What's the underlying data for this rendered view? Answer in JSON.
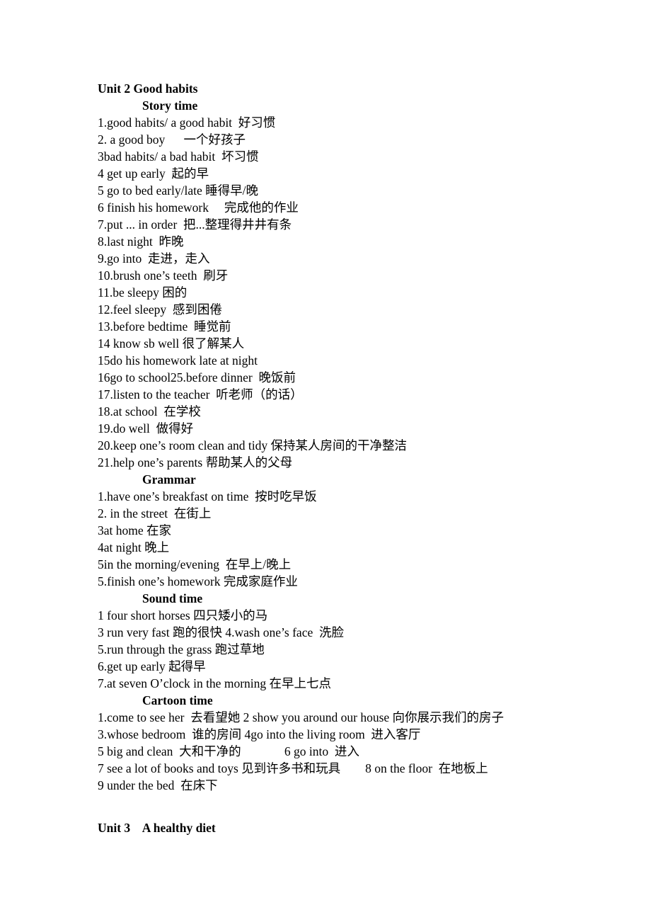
{
  "document": {
    "unit_title": "Unit 2 Good habits",
    "next_unit_title": "Unit 3    A healthy diet",
    "sections": [
      {
        "heading": "Story time",
        "lines": [
          "1.good habits/ a good habit  好习惯",
          "2. a good boy      一个好孩子",
          "3bad habits/ a bad habit  坏习惯",
          "4 get up early  起的早",
          "5 go to bed early/late 睡得早/晚",
          "6 finish his homework     完成他的作业",
          "7.put ... in order  把...整理得井井有条",
          "8.last night  昨晚",
          "9.go into  走进，走入",
          "10.brush one’s teeth  刷牙",
          "11.be sleepy 困的",
          "12.feel sleepy  感到困倦",
          "13.before bedtime  睡觉前",
          "14 know sb well 很了解某人",
          "15do his homework late at night",
          "16go to school25.before dinner  晚饭前",
          "17.listen to the teacher  听老师（的话）",
          "18.at school  在学校",
          "19.do well  做得好",
          "20.keep one’s room clean and tidy 保持某人房间的干净整洁",
          "21.help one’s parents 帮助某人的父母"
        ]
      },
      {
        "heading": "Grammar",
        "lines": [
          "1.have one’s breakfast on time  按时吃早饭",
          "2. in the street  在街上",
          "3at home 在家",
          "4at night 晚上",
          "5in the morning/evening  在早上/晚上",
          "5.finish one’s homework 完成家庭作业"
        ]
      },
      {
        "heading": "Sound time",
        "lines": [
          "1 four short horses 四只矮小的马",
          "3 run very fast 跑的很快 4.wash one’s face  洗脸",
          "5.run through the grass 跑过草地",
          "6.get up early 起得早",
          "7.at seven O’clock in the morning 在早上七点"
        ]
      },
      {
        "heading": "Cartoon time",
        "lines": [
          "1.come to see her  去看望她 2 show you around our house 向你展示我们的房子",
          "3.whose bedroom  谁的房间 4go into the living room  进入客厅",
          "5 big and clean  大和干净的              6 go into  进入",
          "7 see a lot of books and toys 见到许多书和玩具        8 on the floor  在地板上",
          "9 under the bed  在床下"
        ]
      }
    ]
  }
}
